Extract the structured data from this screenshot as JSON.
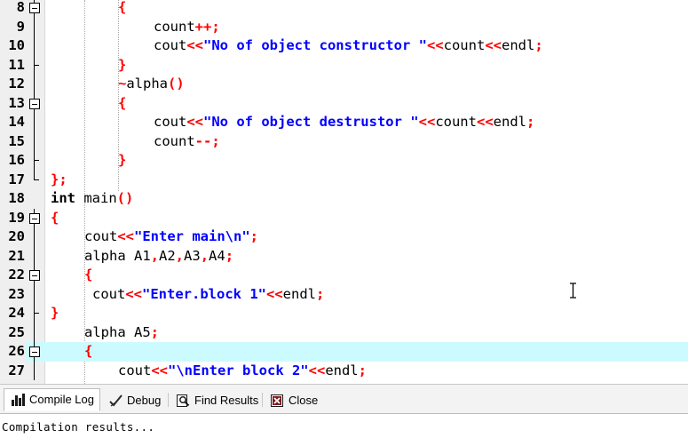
{
  "editor": {
    "current_line": 26,
    "lines": [
      {
        "num": "8",
        "fold": "box"
      },
      {
        "num": "9",
        "fold": "line"
      },
      {
        "num": "10",
        "fold": "line"
      },
      {
        "num": "11",
        "fold": "tick"
      },
      {
        "num": "12",
        "fold": "line"
      },
      {
        "num": "13",
        "fold": "box"
      },
      {
        "num": "14",
        "fold": "line"
      },
      {
        "num": "15",
        "fold": "line"
      },
      {
        "num": "16",
        "fold": "tick"
      },
      {
        "num": "17",
        "fold": "end"
      },
      {
        "num": "18",
        "fold": "none"
      },
      {
        "num": "19",
        "fold": "box"
      },
      {
        "num": "20",
        "fold": "line"
      },
      {
        "num": "21",
        "fold": "line"
      },
      {
        "num": "22",
        "fold": "box"
      },
      {
        "num": "23",
        "fold": "line"
      },
      {
        "num": "24",
        "fold": "tick"
      },
      {
        "num": "25",
        "fold": "line"
      },
      {
        "num": "26",
        "fold": "box"
      },
      {
        "num": "27",
        "fold": "line"
      }
    ],
    "code": {
      "l8": [
        "{"
      ],
      "l9": [
        "count",
        "++",
        ";"
      ],
      "l10": [
        "cout",
        "<<",
        "\"No of object constructor \"",
        "<<",
        "count",
        "<<",
        "endl",
        ";"
      ],
      "l11": [
        "}"
      ],
      "l12": [
        "~",
        "alpha",
        "()"
      ],
      "l13": [
        "{"
      ],
      "l14": [
        "cout",
        "<<",
        "\"No of object destrustor \"",
        "<<",
        "count",
        "<<",
        "endl",
        ";"
      ],
      "l15": [
        "count",
        "--",
        ";"
      ],
      "l16": [
        "}"
      ],
      "l17": [
        "};"
      ],
      "l18": [
        "int",
        " main",
        "()"
      ],
      "l19": [
        "{"
      ],
      "l20": [
        "cout",
        "<<",
        "\"Enter main\\n\"",
        ";"
      ],
      "l21": [
        "alpha A1",
        ",",
        "A2",
        ",",
        "A3",
        ",",
        "A4",
        ";"
      ],
      "l22": [
        "{"
      ],
      "l23": [
        "cout",
        "<<",
        "\"Enter.block 1\"",
        "<<",
        "endl",
        ";"
      ],
      "l24": [
        "}"
      ],
      "l25": [
        "alpha A5",
        ";"
      ],
      "l26": [
        "{"
      ],
      "l27": [
        "cout",
        "<<",
        "\"\\nEnter block 2\"",
        "<<",
        "endl",
        ";"
      ]
    }
  },
  "tabs": {
    "compile_log": "Compile Log",
    "debug": "Debug",
    "find_results": "Find Results",
    "close": "Close"
  },
  "log": {
    "text": "Compilation results..."
  },
  "colors": {
    "string": "#0000ff",
    "punct": "#ff0000",
    "current_line": "#ccfbff"
  }
}
